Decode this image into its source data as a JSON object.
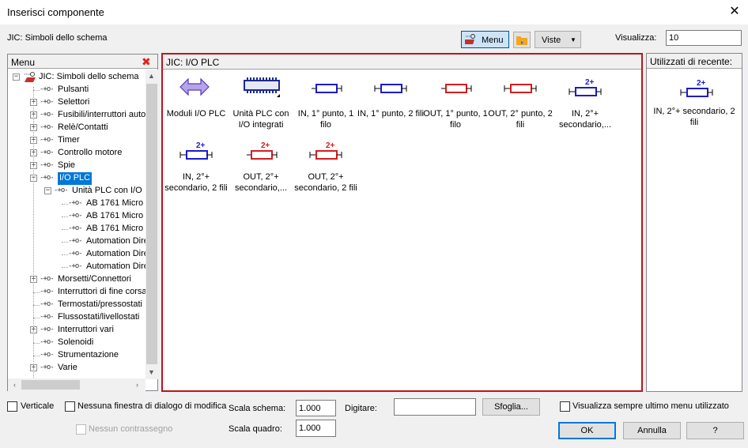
{
  "window": {
    "title": "Inserisci componente",
    "close_glyph": "✕"
  },
  "library_label": "JIC: Simboli dello schema",
  "toolbar": {
    "menu_label": "Menu",
    "viste_label": "Viste",
    "visualizza_label": "Visualizza:",
    "visualizza_value": "10"
  },
  "menu_panel": {
    "header": "Menu",
    "close_glyph": "✖",
    "tree": [
      {
        "label": "JIC: Simboli dello schema",
        "level": 0,
        "expander": "−",
        "icon": "library-icon"
      },
      {
        "label": "Pulsanti",
        "level": 1,
        "expander": ""
      },
      {
        "label": "Selettori",
        "level": 1,
        "expander": "+"
      },
      {
        "label": "Fusibili/interruttori autor",
        "level": 1,
        "expander": "+"
      },
      {
        "label": "Relè/Contatti",
        "level": 1,
        "expander": "+"
      },
      {
        "label": "Timer",
        "level": 1,
        "expander": "+"
      },
      {
        "label": "Controllo motore",
        "level": 1,
        "expander": "+"
      },
      {
        "label": "Spie",
        "level": 1,
        "expander": "+"
      },
      {
        "label": "I/O PLC",
        "level": 1,
        "expander": "−",
        "selected": true
      },
      {
        "label": "Unità PLC con I/O",
        "level": 2,
        "expander": "−"
      },
      {
        "label": "AB 1761 Micro",
        "level": 3,
        "expander": ""
      },
      {
        "label": "AB 1761 Micro",
        "level": 3,
        "expander": ""
      },
      {
        "label": "AB 1761 Micro",
        "level": 3,
        "expander": ""
      },
      {
        "label": "Automation Dire",
        "level": 3,
        "expander": ""
      },
      {
        "label": "Automation Dire",
        "level": 3,
        "expander": ""
      },
      {
        "label": "Automation Dire",
        "level": 3,
        "expander": ""
      },
      {
        "label": "Morsetti/Connettori",
        "level": 1,
        "expander": "+"
      },
      {
        "label": "Interruttori di fine corsa",
        "level": 1,
        "expander": ""
      },
      {
        "label": "Termostati/pressostati",
        "level": 1,
        "expander": ""
      },
      {
        "label": "Flussostati/livellostati",
        "level": 1,
        "expander": ""
      },
      {
        "label": "Interruttori vari",
        "level": 1,
        "expander": "+"
      },
      {
        "label": "Solenoidi",
        "level": 1,
        "expander": ""
      },
      {
        "label": "Strumentazione",
        "level": 1,
        "expander": ""
      },
      {
        "label": "Varie",
        "level": 1,
        "expander": "+"
      }
    ]
  },
  "symbols_panel": {
    "header": "JIC: I/O PLC",
    "items": [
      {
        "label": "Moduli I/O PLC",
        "icon": "double-arrow-icon"
      },
      {
        "label": "Unità PLC con I/O integrati",
        "icon": "plc-rack-icon"
      },
      {
        "label": "IN, 1° punto, 1 filo",
        "icon": "in-1wire-icon",
        "color": "#1c1cc8"
      },
      {
        "label": "IN, 1° punto, 2 fili",
        "icon": "in-2wire-icon",
        "color": "#1c1cc8"
      },
      {
        "label": "OUT, 1° punto, 1 filo",
        "icon": "out-1wire-icon",
        "color": "#d21e1e"
      },
      {
        "label": "OUT, 2° punto, 2 fili",
        "icon": "out-2wire-icon",
        "color": "#d21e1e"
      },
      {
        "label": "IN, 2°+ secondario,...",
        "icon": "in-secondary-icon",
        "color": "#1c1cc8",
        "badge": "2+"
      },
      {
        "label": "IN, 2°+ secondario, 2 fili",
        "icon": "in-secondary-2wire-icon",
        "color": "#1c1cc8",
        "badge": "2+"
      },
      {
        "label": "OUT, 2°+ secondario,...",
        "icon": "out-secondary-icon",
        "color": "#d21e1e",
        "badge": "2+"
      },
      {
        "label": "OUT, 2°+ secondario, 2 fili",
        "icon": "out-secondary-2wire-icon",
        "color": "#d21e1e",
        "badge": "2+"
      }
    ]
  },
  "recent_panel": {
    "header": "Utilizzati di recente:",
    "items": [
      {
        "label": "IN, 2°+ secondario, 2 fili",
        "badge": "2+",
        "color": "#1c1cc8"
      }
    ]
  },
  "bottom": {
    "verticale_label": "Verticale",
    "nessuna_finestra_label": "Nessuna finestra di dialogo di modifica",
    "nessun_contrassegno_label": "Nessun contrassegno",
    "scala_schema_label": "Scala schema:",
    "scala_schema_value": "1.000",
    "scala_quadro_label": "Scala quadro:",
    "scala_quadro_value": "1.000",
    "digitare_label": "Digitare:",
    "digitare_value": "",
    "sfoglia_label": "Sfoglia...",
    "visualizza_sempre_label": "Visualizza sempre ultimo menu utilizzato",
    "ok_label": "OK",
    "annulla_label": "Annulla",
    "help_label": "?"
  },
  "colors": {
    "selection": "#0078d7",
    "highlight_border": "#c0141c"
  }
}
